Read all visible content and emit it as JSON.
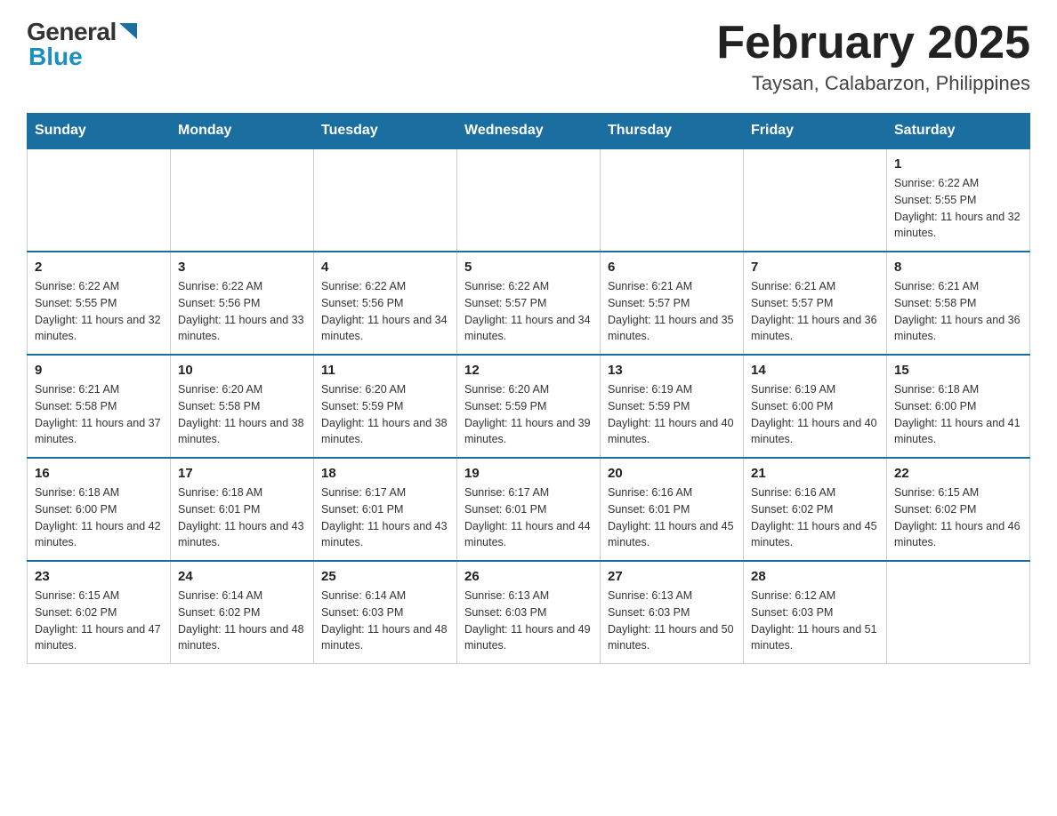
{
  "header": {
    "logo_general": "General",
    "logo_blue": "Blue",
    "title": "February 2025",
    "location": "Taysan, Calabarzon, Philippines"
  },
  "days_of_week": [
    "Sunday",
    "Monday",
    "Tuesday",
    "Wednesday",
    "Thursday",
    "Friday",
    "Saturday"
  ],
  "weeks": [
    {
      "days": [
        {
          "date": "",
          "sunrise": "",
          "sunset": "",
          "daylight": ""
        },
        {
          "date": "",
          "sunrise": "",
          "sunset": "",
          "daylight": ""
        },
        {
          "date": "",
          "sunrise": "",
          "sunset": "",
          "daylight": ""
        },
        {
          "date": "",
          "sunrise": "",
          "sunset": "",
          "daylight": ""
        },
        {
          "date": "",
          "sunrise": "",
          "sunset": "",
          "daylight": ""
        },
        {
          "date": "",
          "sunrise": "",
          "sunset": "",
          "daylight": ""
        },
        {
          "date": "1",
          "sunrise": "Sunrise: 6:22 AM",
          "sunset": "Sunset: 5:55 PM",
          "daylight": "Daylight: 11 hours and 32 minutes."
        }
      ]
    },
    {
      "days": [
        {
          "date": "2",
          "sunrise": "Sunrise: 6:22 AM",
          "sunset": "Sunset: 5:55 PM",
          "daylight": "Daylight: 11 hours and 32 minutes."
        },
        {
          "date": "3",
          "sunrise": "Sunrise: 6:22 AM",
          "sunset": "Sunset: 5:56 PM",
          "daylight": "Daylight: 11 hours and 33 minutes."
        },
        {
          "date": "4",
          "sunrise": "Sunrise: 6:22 AM",
          "sunset": "Sunset: 5:56 PM",
          "daylight": "Daylight: 11 hours and 34 minutes."
        },
        {
          "date": "5",
          "sunrise": "Sunrise: 6:22 AM",
          "sunset": "Sunset: 5:57 PM",
          "daylight": "Daylight: 11 hours and 34 minutes."
        },
        {
          "date": "6",
          "sunrise": "Sunrise: 6:21 AM",
          "sunset": "Sunset: 5:57 PM",
          "daylight": "Daylight: 11 hours and 35 minutes."
        },
        {
          "date": "7",
          "sunrise": "Sunrise: 6:21 AM",
          "sunset": "Sunset: 5:57 PM",
          "daylight": "Daylight: 11 hours and 36 minutes."
        },
        {
          "date": "8",
          "sunrise": "Sunrise: 6:21 AM",
          "sunset": "Sunset: 5:58 PM",
          "daylight": "Daylight: 11 hours and 36 minutes."
        }
      ]
    },
    {
      "days": [
        {
          "date": "9",
          "sunrise": "Sunrise: 6:21 AM",
          "sunset": "Sunset: 5:58 PM",
          "daylight": "Daylight: 11 hours and 37 minutes."
        },
        {
          "date": "10",
          "sunrise": "Sunrise: 6:20 AM",
          "sunset": "Sunset: 5:58 PM",
          "daylight": "Daylight: 11 hours and 38 minutes."
        },
        {
          "date": "11",
          "sunrise": "Sunrise: 6:20 AM",
          "sunset": "Sunset: 5:59 PM",
          "daylight": "Daylight: 11 hours and 38 minutes."
        },
        {
          "date": "12",
          "sunrise": "Sunrise: 6:20 AM",
          "sunset": "Sunset: 5:59 PM",
          "daylight": "Daylight: 11 hours and 39 minutes."
        },
        {
          "date": "13",
          "sunrise": "Sunrise: 6:19 AM",
          "sunset": "Sunset: 5:59 PM",
          "daylight": "Daylight: 11 hours and 40 minutes."
        },
        {
          "date": "14",
          "sunrise": "Sunrise: 6:19 AM",
          "sunset": "Sunset: 6:00 PM",
          "daylight": "Daylight: 11 hours and 40 minutes."
        },
        {
          "date": "15",
          "sunrise": "Sunrise: 6:18 AM",
          "sunset": "Sunset: 6:00 PM",
          "daylight": "Daylight: 11 hours and 41 minutes."
        }
      ]
    },
    {
      "days": [
        {
          "date": "16",
          "sunrise": "Sunrise: 6:18 AM",
          "sunset": "Sunset: 6:00 PM",
          "daylight": "Daylight: 11 hours and 42 minutes."
        },
        {
          "date": "17",
          "sunrise": "Sunrise: 6:18 AM",
          "sunset": "Sunset: 6:01 PM",
          "daylight": "Daylight: 11 hours and 43 minutes."
        },
        {
          "date": "18",
          "sunrise": "Sunrise: 6:17 AM",
          "sunset": "Sunset: 6:01 PM",
          "daylight": "Daylight: 11 hours and 43 minutes."
        },
        {
          "date": "19",
          "sunrise": "Sunrise: 6:17 AM",
          "sunset": "Sunset: 6:01 PM",
          "daylight": "Daylight: 11 hours and 44 minutes."
        },
        {
          "date": "20",
          "sunrise": "Sunrise: 6:16 AM",
          "sunset": "Sunset: 6:01 PM",
          "daylight": "Daylight: 11 hours and 45 minutes."
        },
        {
          "date": "21",
          "sunrise": "Sunrise: 6:16 AM",
          "sunset": "Sunset: 6:02 PM",
          "daylight": "Daylight: 11 hours and 45 minutes."
        },
        {
          "date": "22",
          "sunrise": "Sunrise: 6:15 AM",
          "sunset": "Sunset: 6:02 PM",
          "daylight": "Daylight: 11 hours and 46 minutes."
        }
      ]
    },
    {
      "days": [
        {
          "date": "23",
          "sunrise": "Sunrise: 6:15 AM",
          "sunset": "Sunset: 6:02 PM",
          "daylight": "Daylight: 11 hours and 47 minutes."
        },
        {
          "date": "24",
          "sunrise": "Sunrise: 6:14 AM",
          "sunset": "Sunset: 6:02 PM",
          "daylight": "Daylight: 11 hours and 48 minutes."
        },
        {
          "date": "25",
          "sunrise": "Sunrise: 6:14 AM",
          "sunset": "Sunset: 6:03 PM",
          "daylight": "Daylight: 11 hours and 48 minutes."
        },
        {
          "date": "26",
          "sunrise": "Sunrise: 6:13 AM",
          "sunset": "Sunset: 6:03 PM",
          "daylight": "Daylight: 11 hours and 49 minutes."
        },
        {
          "date": "27",
          "sunrise": "Sunrise: 6:13 AM",
          "sunset": "Sunset: 6:03 PM",
          "daylight": "Daylight: 11 hours and 50 minutes."
        },
        {
          "date": "28",
          "sunrise": "Sunrise: 6:12 AM",
          "sunset": "Sunset: 6:03 PM",
          "daylight": "Daylight: 11 hours and 51 minutes."
        },
        {
          "date": "",
          "sunrise": "",
          "sunset": "",
          "daylight": ""
        }
      ]
    }
  ]
}
